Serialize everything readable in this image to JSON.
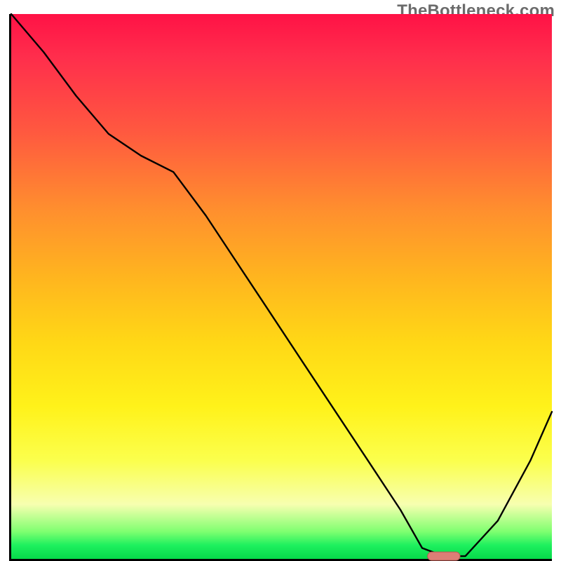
{
  "watermark": "TheBottleneck.com",
  "chart_data": {
    "type": "line",
    "title": "",
    "xlabel": "",
    "ylabel": "",
    "xlim": [
      0,
      100
    ],
    "ylim": [
      0,
      100
    ],
    "grid": false,
    "legend": false,
    "background_gradient": {
      "top": "#ff1246",
      "mid": "#fff21a",
      "bottom": "#06d94a"
    },
    "series": [
      {
        "name": "bottleneck-curve",
        "x": [
          0,
          6,
          12,
          18,
          24,
          30,
          36,
          42,
          48,
          54,
          60,
          66,
          72,
          76,
          80,
          84,
          90,
          96,
          100
        ],
        "y": [
          100,
          93,
          85,
          78,
          74,
          71,
          63,
          54,
          45,
          36,
          27,
          18,
          9,
          2,
          0.5,
          0.5,
          7,
          18,
          27
        ]
      }
    ],
    "marker": {
      "name": "optimal-range",
      "x_center": 80,
      "y": 0.5,
      "width_pct": 6,
      "color": "#dd7e76"
    }
  }
}
